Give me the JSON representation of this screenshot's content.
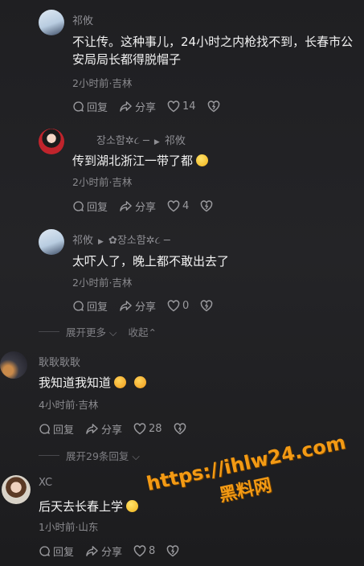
{
  "comments": [
    {
      "name": "祁攸",
      "reply_to": "",
      "text_lines": [
        "不让传。这种事儿，24小时之内枪找不到，长春市公",
        "安局局长都得脱帽子"
      ],
      "meta": "2小时前·吉林",
      "reply_label": "回复",
      "share_label": "分享",
      "likes": "14"
    },
    {
      "name": "장소함✲૮ ─",
      "reply_to": "祁攸",
      "text_lines": [
        "传到湖北浙江一带了都"
      ],
      "meta": "2小时前·吉林",
      "reply_label": "回复",
      "share_label": "分享",
      "likes": "4"
    },
    {
      "name": "祁攸",
      "reply_to": "✿장소함✲૮ ─",
      "text_lines": [
        "太吓人了，晚上都不敢出去了"
      ],
      "meta": "2小时前·吉林",
      "reply_label": "回复",
      "share_label": "分享",
      "likes": "0"
    }
  ],
  "expand_more": "展开更多",
  "collapse": "收起",
  "top_comments": [
    {
      "name": "耿耿耿耿",
      "text": "我知道我知道",
      "meta": "4小时前·吉林",
      "reply_label": "回复",
      "share_label": "分享",
      "likes": "28"
    },
    {
      "name": "XC",
      "text": "后天去长春上学",
      "meta": "1小时前·山东",
      "reply_label": "回复",
      "share_label": "分享",
      "likes": "8"
    }
  ],
  "expand_replies": "展开29条回复",
  "watermark": {
    "url": "https://ihlw24.com",
    "name": "黑料网"
  }
}
